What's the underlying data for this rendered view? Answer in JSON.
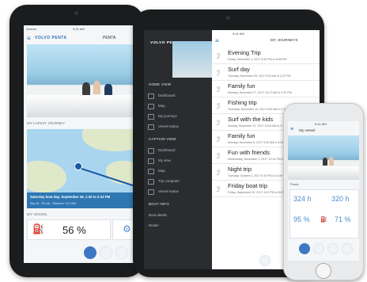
{
  "left_tablet": {
    "status_time": "9:41 AM",
    "carrier": "Verizon",
    "brand": "VOLVO PENTA",
    "header_title": "PENTA",
    "latest_journey_label": "MY LATEST JOURNEY",
    "journey_title": "Saturday boat day. September 26, 1:30 to 2:23 PM",
    "journey_sub": "Sep 26 · 53 min · Distance: 13.2 NM",
    "vessel_label": "MY VESSEL",
    "fuel_value": "56 %"
  },
  "center_tablet": {
    "status_time": "9:41 AM",
    "brand": "VOLVO PENTA",
    "header_title": "MY JOURNEYS",
    "sidebar": {
      "sections": [
        {
          "title": "HOME VIEW",
          "items": [
            "Dashboard",
            "Map",
            "My journeys",
            "Vessel status"
          ]
        },
        {
          "title": "CAPTAIN VIEW",
          "items": [
            "Dashboard",
            "My view",
            "Map",
            "Trip computer",
            "Vessel status"
          ]
        },
        {
          "title": "BOAT INFO",
          "items": [
            "Boat details",
            "Dealer"
          ]
        }
      ]
    },
    "trips": [
      {
        "title": "Evening Trip",
        "sub": "Friday, December 1, 2017  5:42 PM to 6:58 PM"
      },
      {
        "title": "Surf day",
        "sub": "Tuesday, November 28, 2017  9:03 AM to 3:47 PM"
      },
      {
        "title": "Family fun",
        "sub": "Monday, November 27, 2017  10:17 AM to 4:32 PM"
      },
      {
        "title": "Fishing trip",
        "sub": "Thursday, November 16, 2017  6:00 AM to 1:15 PM"
      },
      {
        "title": "Surf with the kids",
        "sub": "Sunday, November 12, 2017  11:00 AM to 2:45 PM"
      },
      {
        "title": "Family fun",
        "sub": "Monday, November 6, 2017  9:30 AM to 5:20 PM"
      },
      {
        "title": "Fun with friends",
        "sub": "Wednesday, November 1, 2017  12:10 PM to 6:40 PM"
      },
      {
        "title": "Night trip",
        "sub": "Tuesday, October 3, 2017  8:15 PM to 11:50 PM"
      },
      {
        "title": "Friday boat trip",
        "sub": "Friday, September 29, 2017  4:00 PM to 8:20 PM"
      }
    ]
  },
  "phone": {
    "status_time": "9:41 AM",
    "header_title": "My vessel",
    "vessel_name": "Penta",
    "stats": {
      "hours_left": "324 h",
      "hours_right": "320 h",
      "pct_left": "95 %",
      "pct_right": "71 %"
    }
  }
}
